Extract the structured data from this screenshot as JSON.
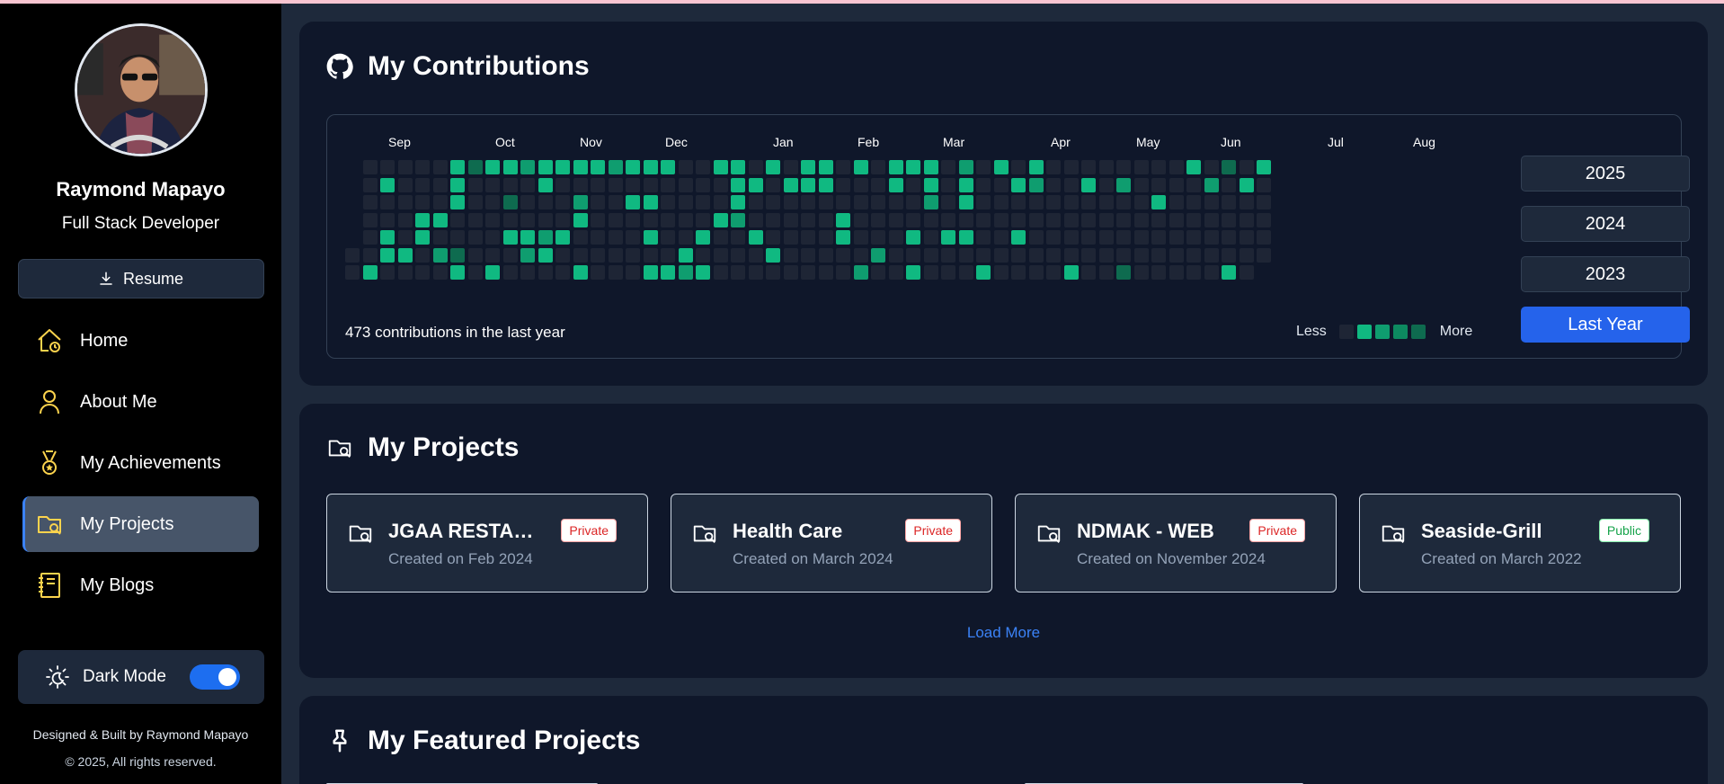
{
  "sidebar": {
    "name": "Raymond Mapayo",
    "role": "Full Stack Developer",
    "resume_label": "Resume",
    "nav": [
      {
        "label": "Home",
        "icon": "home-icon"
      },
      {
        "label": "About Me",
        "icon": "user-icon"
      },
      {
        "label": "My Achievements",
        "icon": "medal-icon"
      },
      {
        "label": "My Projects",
        "icon": "folder-search-icon",
        "active": true
      },
      {
        "label": "My Blogs",
        "icon": "notebook-icon"
      }
    ],
    "dark_mode_label": "Dark Mode",
    "dark_mode_on": true,
    "credit": "Designed & Built by Raymond Mapayo",
    "copyright": "© 2025, All rights reserved."
  },
  "contributions": {
    "title": "My Contributions",
    "months": [
      "Sep",
      "Oct",
      "Nov",
      "Dec",
      "Jan",
      "Feb",
      "Mar",
      "Apr",
      "May",
      "Jun",
      "Jul",
      "Aug"
    ],
    "total_text": "473 contributions in the last year",
    "legend_less": "Less",
    "legend_more": "More",
    "years": [
      "2025",
      "2024",
      "2023",
      "Last Year"
    ],
    "active_year": "Last Year",
    "colors": {
      "empty": "#1e2535",
      "l1": "#0e6b4f",
      "l2": "#0f9d6f",
      "l3": "#10b981"
    }
  },
  "projects": {
    "title": "My Projects",
    "items": [
      {
        "name": "JGAA RESTAURANT",
        "date": "Created on Feb 2024",
        "visibility": "Private"
      },
      {
        "name": "Health Care",
        "date": "Created on March 2024",
        "visibility": "Private"
      },
      {
        "name": "NDMAK - WEB",
        "date": "Created on November 2024",
        "visibility": "Private"
      },
      {
        "name": "Seaside-Grill",
        "date": "Created on March 2022",
        "visibility": "Public"
      }
    ],
    "load_more": "Load More"
  },
  "featured": {
    "title": "My Featured Projects"
  }
}
